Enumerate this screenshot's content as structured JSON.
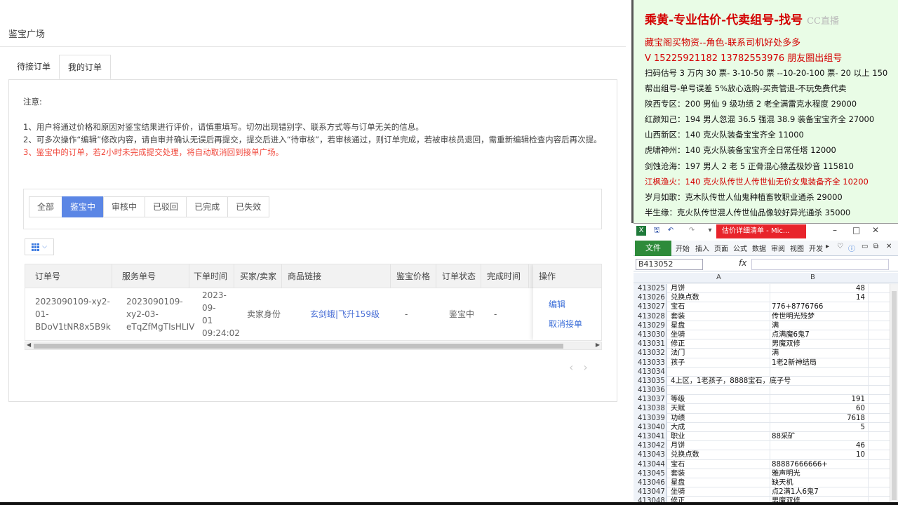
{
  "web": {
    "page_title": "鉴宝广场",
    "tabs": [
      "待接订单",
      "我的订单"
    ],
    "notice": {
      "title": "注意:",
      "line1": "1、用户将通过价格和原因对鉴宝结果进行评价，请慎重填写。切勿出现错别字、联系方式等与订单无关的信息。",
      "line2": "2、可多次操作“编辑”修改内容，请自审并确认无误后再提交，提交后进入“待审核”，若审核通过，则订单完成，若被审核员退回，需重新编辑检查内容后再次提。",
      "line3": "3、鉴宝中的订单，若2小时未完成提交处理，将自动取消回到接单广场。"
    },
    "filters": [
      "全部",
      "鉴宝中",
      "审核中",
      "已驳回",
      "已完成",
      "已失效"
    ],
    "active_filter": "鉴宝中",
    "columns": [
      "订单号",
      "服务单号",
      "下单时间",
      "买家/卖家",
      "商品链接",
      "鉴宝价格",
      "订单状态",
      "完成时间",
      "操作"
    ],
    "row": {
      "order_no": [
        "2023090109-xy2-",
        "01-",
        "BDoV1tNR8x5B9k"
      ],
      "service_no": [
        "2023090109-",
        "xy2-03-",
        "eTqZfMgTIsHLIV"
      ],
      "order_time": [
        "2023-09-",
        "01",
        "09:24:02"
      ],
      "party": "卖家身份",
      "link": "玄剑蛾|飞升159级",
      "price": "-",
      "status": "鉴宝中",
      "finish_time": "-",
      "ops": [
        "编辑",
        "取消接单"
      ]
    },
    "pager": {
      "prev": "‹",
      "next": "›"
    }
  },
  "promo": {
    "title": "乘黄-专业估价-代卖组号-找号",
    "watermark": "CC直播",
    "line_red1": "藏宝阁买物资--角色-联系司机好处多多",
    "line_red2": "V 15225921182       13782553976 朋友圈出组号",
    "lines": [
      "扫码估号 3 万内 30 票- 3-10-50 票  --10-20-100 票- 20 以上 150",
      "帮出组号-单号误差 5%放心选购-买贵管退-不玩免费代卖",
      "陕西专区：200 男仙 9 级功绩 2 老全满雷克水程度 29000",
      "红颜知己：194 男人忽混 36.5 强混 38.9 装备宝宝齐全 27000",
      "山西新区：140 克火队装备宝宝齐全 11000",
      "虎啸神州：140 克火队装备宝宝齐全日常任塔 12000",
      "剑蚀沧海：197 男人 2 老 5 正骨混心猿孟极妙音 115810",
      "江枫渔火：140 克火队传世人传世仙无价女鬼装备齐全 10200",
      "岁月如歌：克木队传世人仙鬼种植畜牧职业通杀 29000",
      "半生缘：克火队传世混人传世仙品像较好异光通杀 35000"
    ]
  },
  "excel": {
    "title": "估价详细清单 - Mic...",
    "ribbon_file": "文件",
    "ribbon_tabs": [
      "开始",
      "插入",
      "页面",
      "公式",
      "数据",
      "审阅",
      "视图",
      "开发"
    ],
    "name_box": "B413052",
    "fx": "fx",
    "col_a": "A",
    "col_b": "B",
    "rows": [
      {
        "n": "413025",
        "a": "月饼",
        "b": "48",
        "num": true
      },
      {
        "n": "413026",
        "a": "兑换点数",
        "b": "14",
        "num": true
      },
      {
        "n": "413027",
        "a": "宝石",
        "b": "776+8776766",
        "num": false
      },
      {
        "n": "413028",
        "a": "套装",
        "b": "传世明光残梦",
        "num": false
      },
      {
        "n": "413029",
        "a": "星盘",
        "b": "满",
        "num": false
      },
      {
        "n": "413030",
        "a": "坐骑",
        "b": "点满魔6鬼7",
        "num": false
      },
      {
        "n": "413031",
        "a": "修正",
        "b": "男魔双修",
        "num": false
      },
      {
        "n": "413032",
        "a": "法门",
        "b": "满",
        "num": false
      },
      {
        "n": "413033",
        "a": "孩子",
        "b": "1老2新神结局",
        "num": false
      },
      {
        "n": "413034",
        "a": "",
        "b": "",
        "num": false
      },
      {
        "n": "413035",
        "a": "4上区，1老孩子，8888宝石，底子号",
        "b": "",
        "num": false
      },
      {
        "n": "413036",
        "a": "",
        "b": "",
        "num": false
      },
      {
        "n": "413037",
        "a": "等级",
        "b": "191",
        "num": true
      },
      {
        "n": "413038",
        "a": "天赋",
        "b": "60",
        "num": true
      },
      {
        "n": "413039",
        "a": "功绩",
        "b": "7618",
        "num": true
      },
      {
        "n": "413040",
        "a": "大成",
        "b": "5",
        "num": true
      },
      {
        "n": "413041",
        "a": "职业",
        "b": "88采矿",
        "num": false
      },
      {
        "n": "413042",
        "a": "月饼",
        "b": "46",
        "num": true
      },
      {
        "n": "413043",
        "a": "兑换点数",
        "b": "10",
        "num": true
      },
      {
        "n": "413044",
        "a": "宝石",
        "b": "88887666666+",
        "num": false
      },
      {
        "n": "413045",
        "a": "套装",
        "b": "雅声明光",
        "num": false
      },
      {
        "n": "413046",
        "a": "星盘",
        "b": "缺天机",
        "num": false
      },
      {
        "n": "413047",
        "a": "坐骑",
        "b": "点2满1人6鬼7",
        "num": false
      },
      {
        "n": "413048",
        "a": "修正",
        "b": "男魔双修",
        "num": false
      }
    ]
  },
  "colors": {
    "accent": "#5b86e5",
    "warn": "#f0483c",
    "promo_bg": "#e9fce6",
    "promo_red": "#d40000",
    "excel_green": "#2e8b3a"
  }
}
